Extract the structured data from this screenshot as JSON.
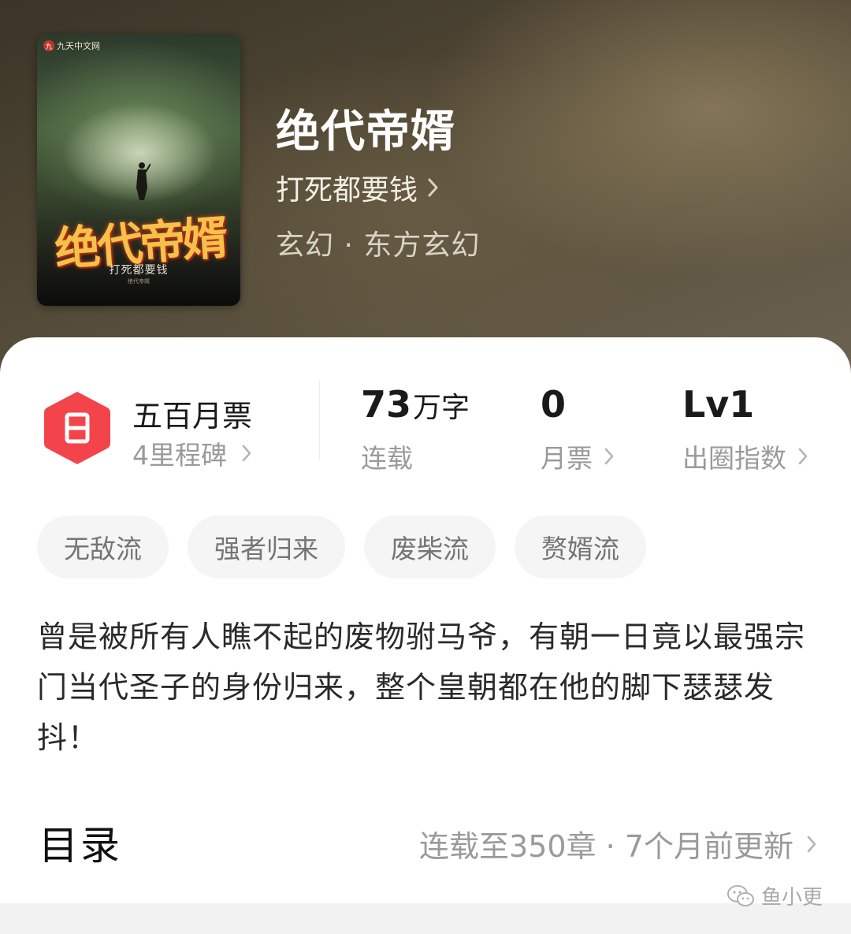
{
  "book": {
    "cover": {
      "publisher": "九天中文网",
      "title_art": "绝代帝婿",
      "author_art": "打死都要钱",
      "subtitle_art": "绝代帝婿"
    },
    "title": "绝代帝婿",
    "author": "打死都要钱",
    "genre": "玄幻 · 东方玄幻"
  },
  "stats": {
    "milestone": {
      "title": "五百月票",
      "subtitle": "4里程碑"
    },
    "words": {
      "value": "73",
      "unit": "万字",
      "label": "连载"
    },
    "tickets": {
      "value": "0",
      "label": "月票"
    },
    "index": {
      "value": "Lv1",
      "label": "出圈指数"
    }
  },
  "tags": [
    "无敌流",
    "强者归来",
    "废柴流",
    "赘婿流"
  ],
  "synopsis": "曾是被所有人瞧不起的废物驸马爷，有朝一日竟以最强宗门当代圣子的身份归来，整个皇朝都在他的脚下瑟瑟发抖！",
  "toc": {
    "title": "目录",
    "info": "连载至350章 · 7个月前更新"
  },
  "watermark": "鱼小更",
  "colors": {
    "accent_red": "#f2444a",
    "text_dark": "#1a1a1a",
    "text_gray": "#9a9a9a",
    "tag_bg": "#f5f5f5"
  }
}
